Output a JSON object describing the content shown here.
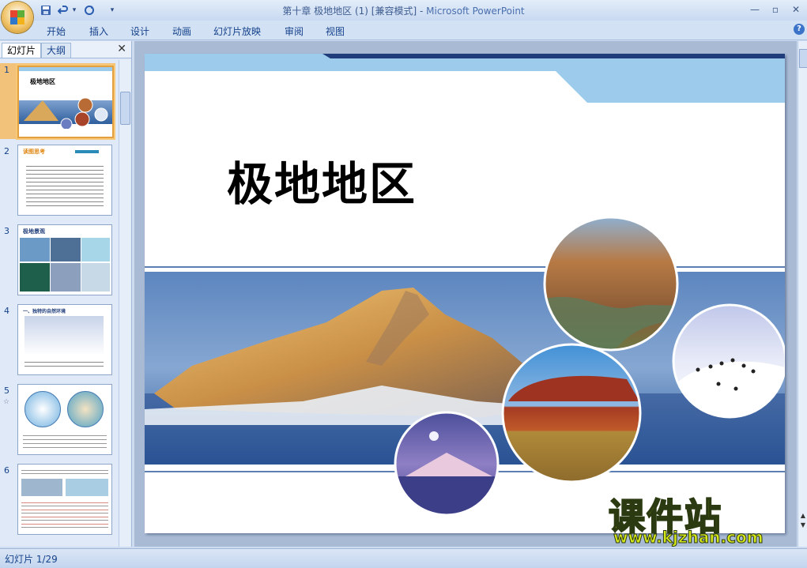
{
  "window": {
    "title": "第十章 极地地区 (1) [兼容模式]",
    "app_name": "Microsoft PowerPoint",
    "separator": " - "
  },
  "quick_access": {
    "save_icon": "save-icon",
    "undo_icon": "undo-icon",
    "redo_icon": "repeat-icon",
    "dropdown_glyph": "▾",
    "customize_glyph": "▾"
  },
  "ribbon": {
    "tabs": [
      "开始",
      "插入",
      "设计",
      "动画",
      "幻灯片放映",
      "审阅",
      "视图"
    ],
    "help": "?"
  },
  "left_pane": {
    "tabs": [
      "幻灯片",
      "大纲"
    ],
    "close": "✕",
    "thumbnails": [
      {
        "number": "1",
        "selected": true,
        "title": "极地地区"
      },
      {
        "number": "2",
        "title": "读图思考"
      },
      {
        "number": "3",
        "title": "极地景观"
      },
      {
        "number": "4",
        "title": "一、独特的自然环境"
      },
      {
        "number": "5",
        "has_animation": true
      },
      {
        "number": "6"
      }
    ]
  },
  "slide": {
    "title": "极地地区"
  },
  "status_bar": {
    "text": "幻灯片 1/29"
  },
  "watermark": {
    "cn": "课件站",
    "url": "www.kjzhan.com"
  },
  "colors": {
    "ribbon_bg": "#d2e1f4",
    "slide_band_blue": "#2f5f9e",
    "header_light_blue": "#9ccbeb",
    "header_navy": "#1f3d7a",
    "watermark_yellow": "#d7e81a"
  }
}
